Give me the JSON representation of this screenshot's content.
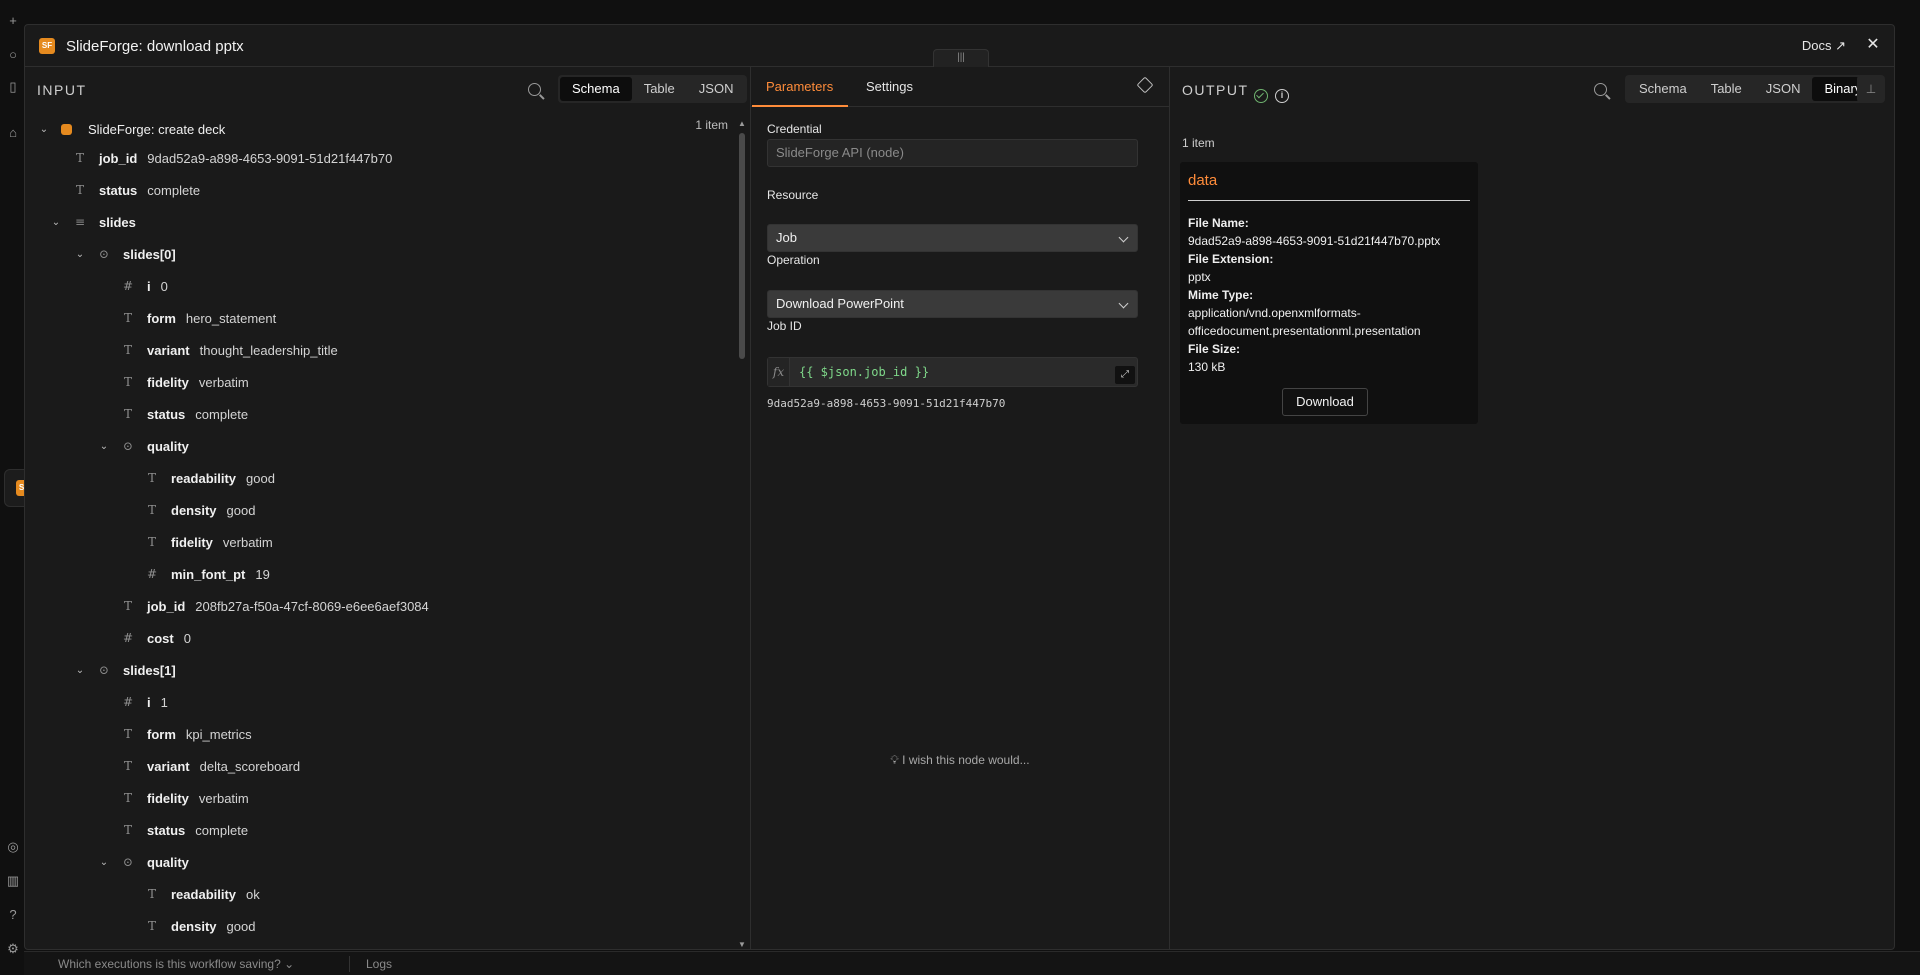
{
  "modal": {
    "logo_text": "SF",
    "title": "SlideForge: download pptx",
    "docs_label": "Docs",
    "close_glyph": "✕",
    "drag_glyph": "|||"
  },
  "input": {
    "title": "INPUT",
    "views": [
      "Schema",
      "Table",
      "JSON"
    ],
    "active_view": "Schema",
    "item_count": "1 item",
    "node_name": "SlideForge: create deck",
    "rows": [
      {
        "key": "job_id",
        "val": "9dad52a9-a898-4653-9091-51d21f447b70",
        "type": "T"
      },
      {
        "key": "status",
        "val": "complete",
        "type": "T"
      },
      {
        "key": "slides",
        "val": "",
        "type": "list"
      },
      {
        "key": "slides[0]",
        "val": "",
        "type": "obj"
      },
      {
        "key": "i",
        "val": "0",
        "type": "#"
      },
      {
        "key": "form",
        "val": "hero_statement",
        "type": "T"
      },
      {
        "key": "variant",
        "val": "thought_leadership_title",
        "type": "T"
      },
      {
        "key": "fidelity",
        "val": "verbatim",
        "type": "T"
      },
      {
        "key": "status",
        "val": "complete",
        "type": "T"
      },
      {
        "key": "quality",
        "val": "",
        "type": "obj"
      },
      {
        "key": "readability",
        "val": "good",
        "type": "T"
      },
      {
        "key": "density",
        "val": "good",
        "type": "T"
      },
      {
        "key": "fidelity",
        "val": "verbatim",
        "type": "T"
      },
      {
        "key": "min_font_pt",
        "val": "19",
        "type": "#"
      },
      {
        "key": "job_id",
        "val": "208fb27a-f50a-47cf-8069-e6ee6aef3084",
        "type": "T"
      },
      {
        "key": "cost",
        "val": "0",
        "type": "#"
      },
      {
        "key": "slides[1]",
        "val": "",
        "type": "obj"
      },
      {
        "key": "i",
        "val": "1",
        "type": "#"
      },
      {
        "key": "form",
        "val": "kpi_metrics",
        "type": "T"
      },
      {
        "key": "variant",
        "val": "delta_scoreboard",
        "type": "T"
      },
      {
        "key": "fidelity",
        "val": "verbatim",
        "type": "T"
      },
      {
        "key": "status",
        "val": "complete",
        "type": "T"
      },
      {
        "key": "quality",
        "val": "",
        "type": "obj"
      },
      {
        "key": "readability",
        "val": "ok",
        "type": "T"
      },
      {
        "key": "density",
        "val": "good",
        "type": "T"
      }
    ]
  },
  "params": {
    "tabs": [
      "Parameters",
      "Settings"
    ],
    "active_tab": "Parameters",
    "credential_label": "Credential",
    "credential_value": "SlideForge API (node)",
    "resource_label": "Resource",
    "resource_value": "Job",
    "operation_label": "Operation",
    "operation_value": "Download PowerPoint",
    "jobid_label": "Job ID",
    "jobid_fx": "fx",
    "jobid_expression": "{{ $json.job_id }}",
    "jobid_result": "9dad52a9-a898-4653-9091-51d21f447b70",
    "wish_text": "I wish this node would..."
  },
  "output": {
    "title": "OUTPUT",
    "views": [
      "Schema",
      "Table",
      "JSON",
      "Binary"
    ],
    "active_view": "Binary",
    "item_count": "1 item",
    "card_title": "data",
    "file_name_label": "File Name:",
    "file_name": "9dad52a9-a898-4653-9091-51d21f447b70.pptx",
    "file_ext_label": "File Extension:",
    "file_ext": "pptx",
    "mime_label": "Mime Type:",
    "mime_line1": "application/vnd.openxmlformats-",
    "mime_line2": "officedocument.presentationml.presentation",
    "size_label": "File Size:",
    "size": "130 kB",
    "download_label": "Download"
  },
  "footer": {
    "executions_text": "Which executions is this workflow saving?",
    "logs_label": "Logs"
  },
  "colors": {
    "accent": "#ff8c3a",
    "logo": "#e58a1f",
    "expression": "#7fd88a",
    "success": "#6fb36f"
  }
}
